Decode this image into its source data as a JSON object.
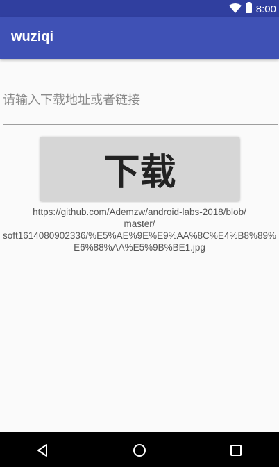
{
  "status_bar": {
    "time": "8:00",
    "icons": [
      "wifi-icon",
      "battery-icon"
    ]
  },
  "app_bar": {
    "title": "wuziqi"
  },
  "form": {
    "url_placeholder": "请输入下载地址或者链接",
    "url_value": "",
    "download_label": "下载"
  },
  "url_display": {
    "lines": [
      "https://github.com/Ademzw/android-labs-2018/blob/",
      "master/",
      "soft1614080902336/%E5%AE%9E%E9%AA%8C%E4%B8%89%",
      "E6%88%AA%E5%9B%BE1.jpg"
    ]
  },
  "nav_bar": {
    "icons": [
      "back-icon",
      "home-icon",
      "recents-icon"
    ]
  },
  "colors": {
    "status_bar": "#303f9f",
    "app_bar": "#3f51b5",
    "button": "#d6d6d6"
  }
}
